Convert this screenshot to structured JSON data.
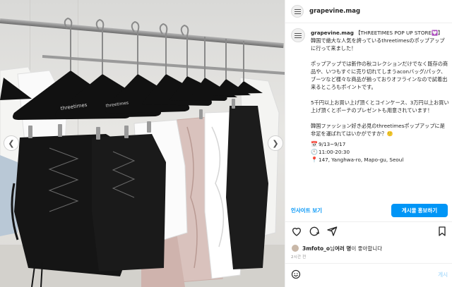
{
  "post": {
    "username": "grapevine.mag",
    "caption": {
      "user": "grapevine.mag",
      "title": "【THREETIMES POP UP STORE💟】",
      "paragraphs": [
        "韓国で絶大な人気を誇っているthreetimesのポップアップに行って来ました！",
        "ポップアップでは新作の秋コレクションだけでなく既存の商品や、いつもすぐに売り切れてしまうaconバッグ/パック、ブーツなど様々な商品が揃っておりオフラインなので試着出来るところもポイントです。",
        "5千円以上お買い上げ頂くとコインケース、3万円以上お買い上げ頂くとポーチのプレゼントも用意されています！",
        "韓国ファッション好き必見のthreetimesポップアップに是非足を運ばれてはいかがですか？🙂"
      ],
      "event": {
        "date_icon": "calendar-icon",
        "date": "9/13~9/17",
        "time_icon": "clock-icon",
        "time": "11:00-20:30",
        "location_icon": "pin-icon",
        "location": "147, Yanghwa-ro, Mapo-gu, Seoul"
      }
    },
    "insights_label": "인사이트 보기",
    "boost_label": "게시물 홍보하기",
    "likes": {
      "user": "3mfoto_o",
      "middle": "님 ",
      "others": "여러 명",
      "suffix": "이 좋아합니다"
    },
    "timestamp": "2시간 전",
    "comment_placeholder": "",
    "post_label": "게시"
  },
  "photo": {
    "hanger_brand": "threetimes"
  },
  "colors": {
    "accent": "#0095f6",
    "text": "#262626",
    "muted": "#8e8e8e"
  }
}
